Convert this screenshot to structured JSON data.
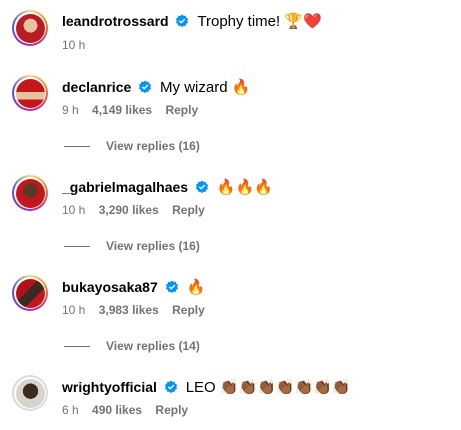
{
  "comments": [
    {
      "username": "leandrotrossard",
      "text": "Trophy time! 🏆❤️",
      "time": "10 h",
      "likes": "",
      "reply": "",
      "view_replies": ""
    },
    {
      "username": "declanrice",
      "text": "My wizard 🔥",
      "time": "9 h",
      "likes": "4,149 likes",
      "reply": "Reply",
      "view_replies": "View replies (16)"
    },
    {
      "username": "_gabrielmagalhaes",
      "text": "🔥🔥🔥",
      "time": "10 h",
      "likes": "3,290 likes",
      "reply": "Reply",
      "view_replies": "View replies (16)"
    },
    {
      "username": "bukayosaka87",
      "text": "🔥",
      "time": "10 h",
      "likes": "3,983 likes",
      "reply": "Reply",
      "view_replies": "View replies (14)"
    },
    {
      "username": "wrightyofficial",
      "text": "LEO 👏🏾👏🏾👏🏾👏🏾👏🏾👏🏾👏🏾",
      "time": "6 h",
      "likes": "490 likes",
      "reply": "Reply",
      "view_replies": ""
    }
  ],
  "colors": {
    "verified": "#0095f6",
    "meta": "#737373"
  },
  "icons": {
    "verified": "verified-badge-icon"
  }
}
